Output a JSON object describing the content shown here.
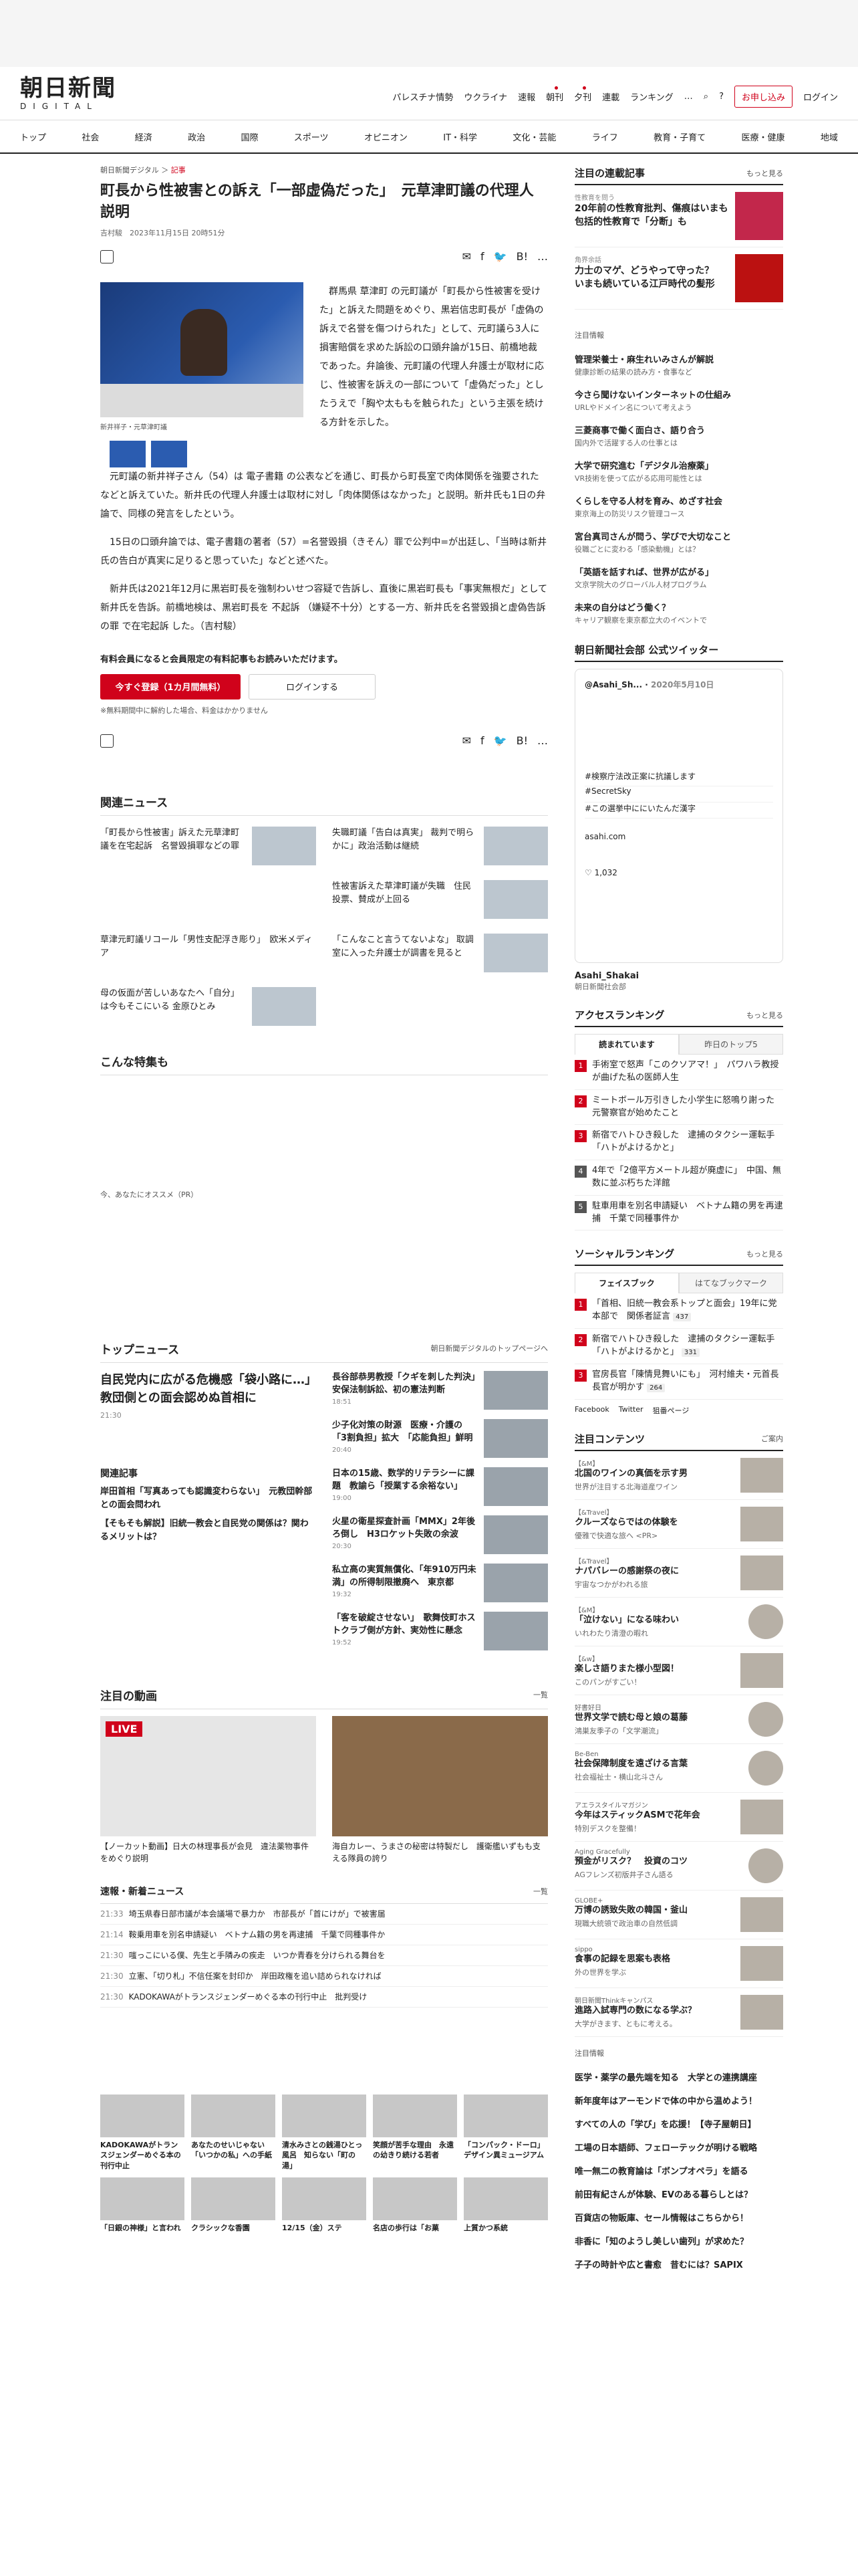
{
  "header": {
    "logo_main": "朝日新聞",
    "logo_sub": "DIGITAL",
    "util": [
      "パレスチナ情勢",
      "ウクライナ",
      "速報",
      "朝刊",
      "夕刊",
      "連載",
      "ランキング",
      "…"
    ],
    "subscribe": "お申し込み",
    "login": "ログイン"
  },
  "gnav": [
    "トップ",
    "社会",
    "経済",
    "政治",
    "国際",
    "スポーツ",
    "オピニオン",
    "IT・科学",
    "文化・芸能",
    "ライフ",
    "教育・子育て",
    "医療・健康",
    "地域"
  ],
  "article": {
    "breadcrumb": "朝日新聞デジタル",
    "category": "記事",
    "title": "町長から性被害との訴え「一部虚偽だった」　元草津町議の代理人説明",
    "byline": "吉村駿　2023年11月15日 20時51分",
    "count": "list",
    "caption": "新井祥子・元草津町議",
    "paragraphs": [
      "群馬県 草津町 の元町議が「町長から性被害を受けた」と訴えた問題をめぐり、黒岩信忠町長が「虚偽の訴えで名誉を傷つけられた」として、元町議ら3人に損害賠償を求めた訴訟の口頭弁論が15日、前橋地裁 であった。弁論後、元町議の代理人弁護士が取材に応じ、性被害を訴えの一部について「虚偽だった」としたうえで「胸や太ももを触られた」という主張を続ける方針を示した。",
      "元町議の新井祥子さん（54）は 電子書籍 の公表などを通じ、町長から町長室で肉体関係を強要されたなどと訴えていた。新井氏の代理人弁護士は取材に対し「肉体関係はなかった」と説明。新井氏も1日の弁論で、同様の発言をしたという。",
      "15日の口頭弁論では、電子書籍の著者（57）=名誉毀損（きそん）罪で公判中=が出廷し、「当時は新井氏の告白が真実に足りると思っていた」などと述べた。",
      "新井氏は2021年12月に黒岩町長を強制わいせつ容疑で告訴し、直後に黒岩町長も「事実無根だ」として新井氏を告訴。前橋地検は、黒岩町長を 不起訴 （嫌疑不十分）とする一方、新井氏を名誉毀損と虚偽告訴の罪 で在宅起訴 した。（吉村駿）"
    ],
    "paywall_text": "有料会員になると会員限定の有料記事もお読みいただけます。",
    "register_btn": "今すぐ登録（1カ月間無料）",
    "login_btn": "ログインする",
    "paywall_note": "※無料期間中に解約した場合、料金はかかりません"
  },
  "related": {
    "title": "関連ニュース",
    "items": [
      "「町長から性被害」訴えた元草津町議を在宅起訴　名誉毀損罪などの罪",
      "失職町議「告白は真実」 裁判で明らかに」政治活動は継続",
      "",
      "性被害訴えた草津町議が失職　住民投票、賛成が上回る",
      "草津元町議リコール「男性支配浮き彫り」　欧米メディア",
      "「こんなこと言うてないよな」 取調室に入った弁護士が調書を見ると",
      "母の仮面が苦しいあなたへ「自分」は今もそこにいる 金原ひとみ",
      ""
    ]
  },
  "feature": {
    "title": "こんな特集も",
    "recommend": "今、あなたにオススメ（PR）"
  },
  "topnews": {
    "title": "トップニュース",
    "more": "朝日新聞デジタルのトップページへ",
    "lead": "自民党内に広がる危機感「袋小路に…」　教団側との面会認めぬ首相に",
    "lead_time": "21:30",
    "items": [
      {
        "t": "長谷部恭男教授「クギを刺した判決」　安保法制訴訟、初の憲法判断",
        "time": "18:51"
      },
      {
        "t": "少子化対策の財源　医療・介護の「3割負担」拡大　「応能負担」鮮明",
        "time": "20:40"
      },
      {
        "t": "日本の15歳、数学的リテラシーに課題　教諭ら「授業する余裕ない」",
        "time": "19:00"
      },
      {
        "t": "火星の衛星探査計画「MMX」2年後ろ倒し　H3ロケット失敗の余波",
        "time": "20:30"
      },
      {
        "t": "私立高の実質無償化、「年910万円未満」の所得制限撤廃へ　東京都",
        "time": "19:32"
      },
      {
        "t": "「客を破綻させない」　歌舞伎町ホストクラブ側が方針、実効性に懸念",
        "time": "19:52"
      }
    ],
    "kanren_title": "関連記事",
    "kanren": [
      "岸田首相「写真あっても認識変わらない」　元教団幹部との面会問われ",
      "【そもそも解説】旧統一教会と自民党の関係は？関わるメリットは？"
    ]
  },
  "video": {
    "title": "注目の動画",
    "more": "一覧",
    "live": "LIVE",
    "items": [
      "【ノーカット動画】日大の林理事長が会見　違法薬物事件をめぐり説明",
      "海自カレー、うまさの秘密は特製だし　護衛艦いずもも支える隊員の誇り"
    ]
  },
  "flash": {
    "title": "速報・新着ニュース",
    "more": "一覧",
    "items": [
      {
        "time": "21:33",
        "t": "埼玉県春日部市議が本会議場で暴力か　市部長が「首にけが」で被害届"
      },
      {
        "time": "21:14",
        "t": "鞍乗用車を別名申請疑い　ベトナム籍の男を再逮捕　千葉で同種事件か"
      },
      {
        "time": "21:30",
        "t": "嗤っこにいる僕、先生と手隣みの疾走　いつか青春を分けられる舞台を"
      },
      {
        "time": "21:30",
        "t": "立憲、「切り札」不信任案を封印か　岸田政権を追い詰められなければ"
      },
      {
        "time": "21:30",
        "t": "KADOKAWAがトランスジェンダーめぐる本の刊行中止　批判受け"
      }
    ]
  },
  "bottom": [
    "KADOKAWAがトランスジェンダーめぐる本の刊行中止",
    "あなたのせいじゃない 「いつかの私」への手紙",
    "清水みさとの銭湯ひとっ風呂　知らない「町の湯」",
    "笑顔が苦手な理由　永遠の幼きり続ける若者",
    "「コンパック・ドーロ」デザイン異ミュージアム",
    "「日銀の神様」と言われ",
    "クラシックな香園",
    "12/15（金）ステ",
    "名店の歩行は「お菓",
    "上質かつ系統"
  ],
  "side": {
    "keyword": {
      "title": "注目の連載記事",
      "more": "もっと見る",
      "items": [
        {
          "lab": "性教育を問う",
          "t": "20年前の性教育批判、傷痕はいまも　包括的性教育で「分断」も"
        },
        {
          "lab": "角界余話",
          "t": "力士のマゲ、どうやって守った？　いまも続いている江戸時代の髪形"
        }
      ]
    },
    "pr_label": "注目情報",
    "pr_items": [
      {
        "a": "管理栄養士・麻生れいみさんが解説",
        "b": "健康診断の結果の読み方・食事など"
      },
      {
        "a": "今さら聞けないインターネットの仕組み",
        "b": "URLやドメイン名について考えよう"
      },
      {
        "a": "三菱商事で働く面白さ、語り合う",
        "b": "国内外で活躍する人の仕事とは"
      },
      {
        "a": "大学で研究進む「デジタル治療薬」",
        "b": "VR技術を使って広がる応用可能性とは"
      },
      {
        "a": "くらしを守る人材を育み、めざす社会",
        "b": "東京海上の防災リスク管理コース"
      },
      {
        "a": "宮台真司さんが問う、学びで大切なこと",
        "b": "役職ごとに変わる「感染動機」とは？"
      },
      {
        "a": "「英語を話すれば、世界が広がる」",
        "b": "文京学院大のグローバル人材プログラム"
      },
      {
        "a": "未来の自分はどう働く？",
        "b": "キャリア観察を東京都立大のイベントで"
      }
    ],
    "twitter": {
      "title": "朝日新聞社会部 公式ツイッター",
      "acct": "@Asahi_Sh...",
      "date": "2020年5月10日",
      "trend1": "#検察庁法改正案に抗議します",
      "trend2": "#SecretSky",
      "trend3": "#この選挙中ににいたんだ漢字",
      "site": "asahi.com",
      "likes": "1,032",
      "handle": "Asahi_Shakai",
      "name": "朝日新聞社会部"
    },
    "access": {
      "title": "アクセスランキング",
      "more": "もっと見る",
      "tab1": "読まれています",
      "tab2": "昨日のトップ5",
      "items": [
        "手術室で怒声「このクソアマ！」　パワハラ教授が曲げた私の医師人生",
        "ミートボール万引きした小学生に怒鳴り謝った　元警察官が始めたこと",
        "新宿でハトひき殺した　逮捕のタクシー運転手「ハトがよけるかと」",
        "4年で「2億平方メートル超が廃虚に」　中国、無数に並ぶ朽ちた洋館",
        "駐車用車を別名申請疑い　ベトナム籍の男を再逮捕　千葉で同種事件か"
      ]
    },
    "social": {
      "title": "ソーシャルランキング",
      "more": "もっと見る",
      "tab1": "フェイスブック",
      "tab2": "はてなブックマーク",
      "items": [
        {
          "t": "「首相、旧統一教会系トップと面会」19年に党本部で　関係者証言",
          "c": "437"
        },
        {
          "t": "新宿でハトひき殺した　逮捕のタクシー運転手「ハトがよけるかと」",
          "c": "331"
        },
        {
          "t": "官房長官「陳情見舞いにも」　河村維夫・元首長長官が明かす",
          "c": "264"
        }
      ],
      "fb": "Facebook",
      "tw": "Twitter",
      "more2": "狙番ページ"
    },
    "contents": {
      "title": "注目コンテンツ",
      "more": "ご案内",
      "items": [
        {
          "lab": "【&M】",
          "t": "北国のワインの真価を示す男",
          "s": "世界が注目する北海道産ワイン"
        },
        {
          "lab": "【&Travel】",
          "t": "クルーズならではの体験を",
          "s": "優雅で快適な旅へ <PR>"
        },
        {
          "lab": "【&Travel】",
          "t": "ナパバレーの感謝祭の夜に",
          "s": "宇宙なつかがわれる旅"
        },
        {
          "lab": "【&M】",
          "t": "「泣けない」になる味わい",
          "s": "いれわたり清澄の暇れ"
        },
        {
          "lab": "【&w】",
          "t": "楽しさ語りまた様小型図！",
          "s": "このパンがすごい！"
        },
        {
          "lab": "好書好日",
          "t": "世界文学で読む母と娘の葛藤",
          "s": "鴻巣友季子の「文学潮流」"
        },
        {
          "lab": "Be-Ben",
          "t": "社会保障制度を遠ざける言葉",
          "s": "社会福祉士・横山北斗さん"
        },
        {
          "lab": "アエラスタイルマガジン",
          "t": "今年はスティックASMで花年会",
          "s": "特別デスクを整備！"
        },
        {
          "lab": "Aging Gracefully",
          "t": "預金がリスク？　投資のコツ",
          "s": "AGフレンズ初版井子さん語る"
        },
        {
          "lab": "GLOBE+",
          "t": "万博の誘致失敗の韓国・釜山",
          "s": "現職大統領で政治車の自然低調"
        },
        {
          "lab": "sippo",
          "t": "食事の記録を思案も表格",
          "s": "外の世界を学ぶ"
        },
        {
          "lab": "朝日新聞Thinkキャンパス",
          "t": "進路入試専門の数になる学ぶ？",
          "s": "大学がきます、ともに考える。"
        }
      ]
    },
    "pr2_label": "注目情報",
    "pr2_items": [
      "医学・薬学の最先端を知る　大学との連携講座",
      "新年度年はアーモンドで体の中から温めよう！",
      "すべての人の「学び」を応援！【寺子屋朝日】",
      "工場の日本語師、フェローテックが明ける戦略",
      "唯一無二の教育論は「ボンプオペラ」を語る",
      "前田有紀さんが体験、EVのある暮らしとは？",
      "百貨店の物販庫、セール情報はこちらから！",
      "非香に「知のようし美しい歯列」が求めた？",
      "子子の時計や広と書愈　昔むには？SAPIX"
    ]
  }
}
